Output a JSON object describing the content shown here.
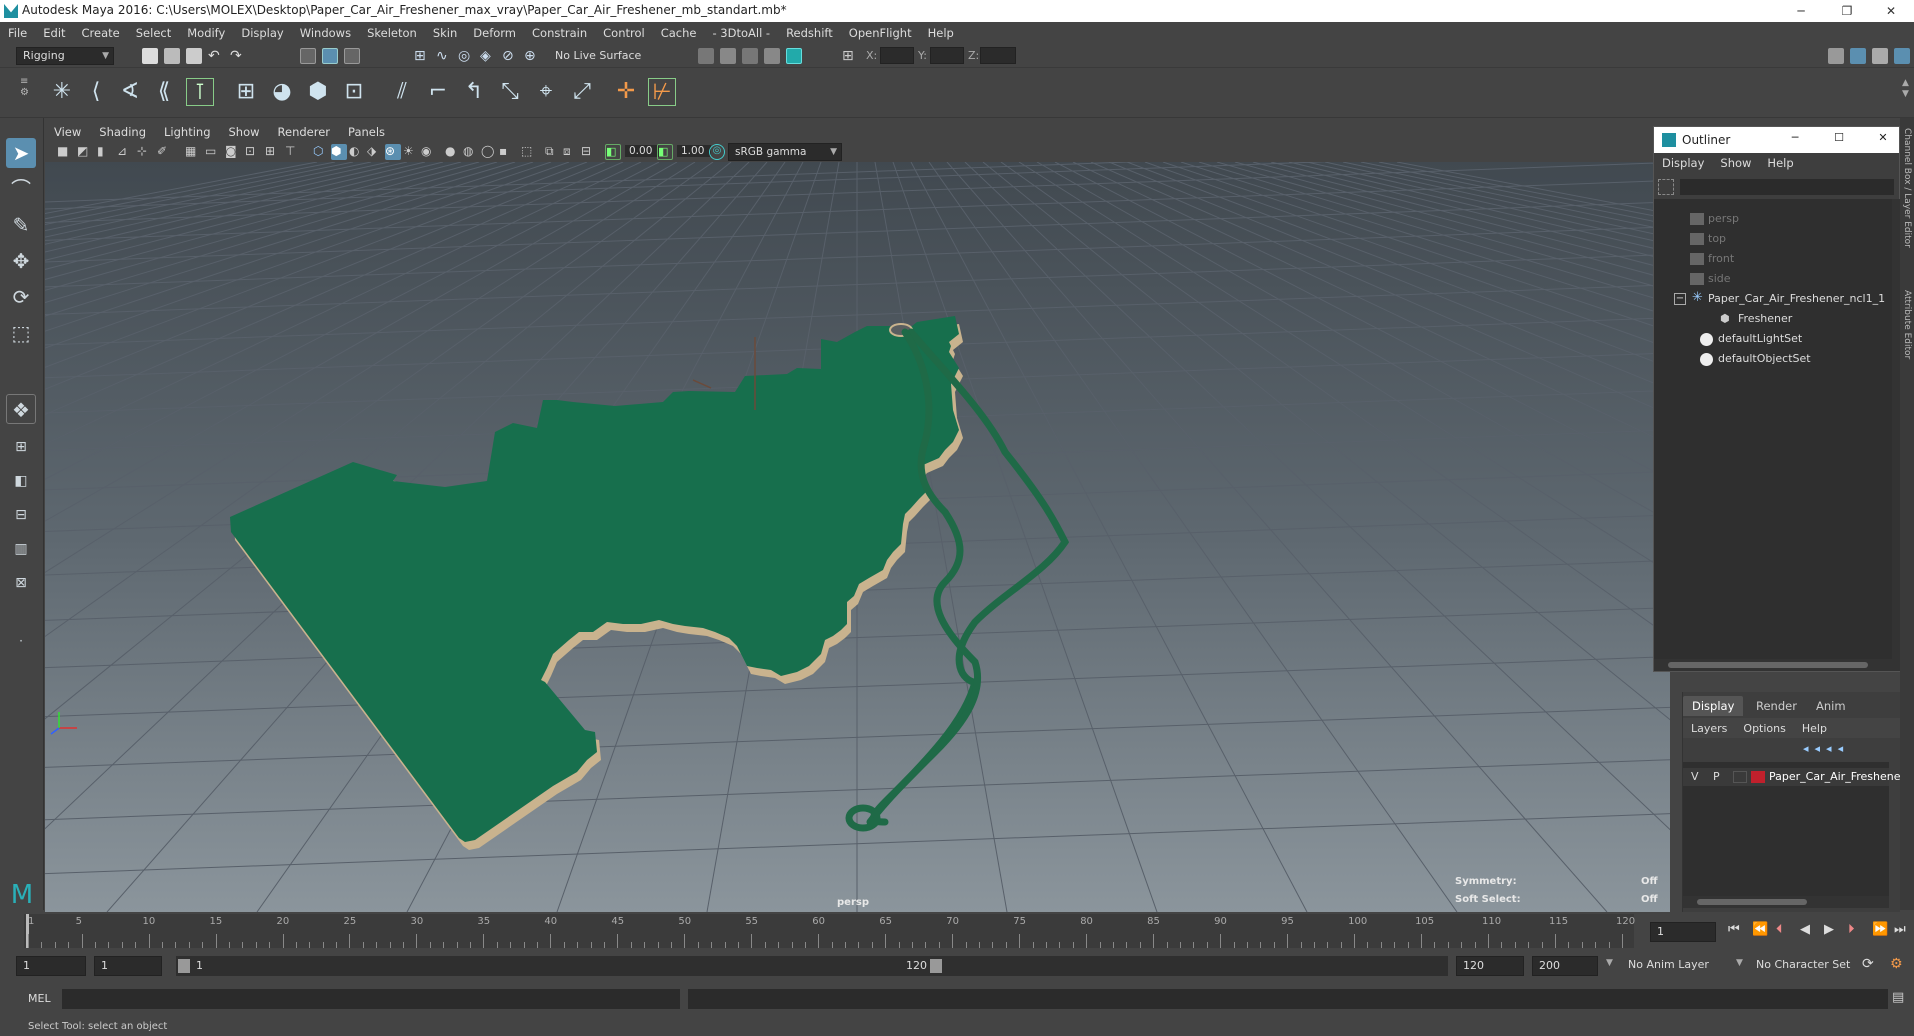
{
  "window": {
    "title": "Autodesk Maya 2016: C:\\Users\\MOLEX\\Desktop\\Paper_Car_Air_Freshener_max_vray\\Paper_Car_Air_Freshener_mb_standart.mb*",
    "minimize": "─",
    "restore": "❐",
    "close": "✕"
  },
  "menubar": [
    "File",
    "Edit",
    "Create",
    "Select",
    "Modify",
    "Display",
    "Windows",
    "Skeleton",
    "Skin",
    "Deform",
    "Constrain",
    "Control",
    "Cache",
    "- 3DtoAll -",
    "Redshift",
    "OpenFlight",
    "Help"
  ],
  "statusline": {
    "mode": "Rigging",
    "live_surface": "No Live Surface",
    "x_label": "X:",
    "y_label": "Y:",
    "z_label": "Z:"
  },
  "viewport": {
    "menu": [
      "View",
      "Shading",
      "Lighting",
      "Show",
      "Renderer",
      "Panels"
    ],
    "exposure": "0.00",
    "gamma": "1.00",
    "color_space": "sRGB gamma",
    "camera_label": "persp",
    "symmetry_label": "Symmetry:",
    "symmetry_value": "Off",
    "soft_select_label": "Soft Select:",
    "soft_select_value": "Off",
    "model_color": "#176f4d",
    "edge_color": "#c9b38e",
    "cord_color": "#1f6a47"
  },
  "outliner": {
    "title": "Outliner",
    "menu": [
      "Display",
      "Show",
      "Help"
    ],
    "items": [
      {
        "label": "persp",
        "dim": true
      },
      {
        "label": "top",
        "dim": true
      },
      {
        "label": "front",
        "dim": true
      },
      {
        "label": "side",
        "dim": true
      },
      {
        "label": "Paper_Car_Air_Freshener_ncl1_1",
        "dim": false
      },
      {
        "label": "Freshener",
        "dim": false
      },
      {
        "label": "defaultLightSet",
        "dim": false
      },
      {
        "label": "defaultObjectSet",
        "dim": false
      }
    ]
  },
  "layer_editor": {
    "tabs": [
      "Display",
      "Render",
      "Anim"
    ],
    "menu": [
      "Layers",
      "Options",
      "Help"
    ],
    "layer": {
      "v": "V",
      "p": "P",
      "name": "Paper_Car_Air_Freshener",
      "color": "#c0202c"
    }
  },
  "right_strip": {
    "channel_box": "Channel Box / Layer Editor",
    "attribute_editor": "Attribute Editor"
  },
  "timeline": {
    "labels": [
      "1",
      "5",
      "10",
      "15",
      "20",
      "25",
      "30",
      "35",
      "40",
      "45",
      "50",
      "55",
      "60",
      "65",
      "70",
      "75",
      "80",
      "85",
      "90",
      "95",
      "100",
      "105",
      "110",
      "115",
      "120"
    ],
    "current_frame": "1"
  },
  "range": {
    "start": "1",
    "playback_start": "1",
    "slider_start": "1",
    "slider_end": "120",
    "playback_end": "120",
    "end": "200",
    "anim_layer": "No Anim Layer",
    "character_set": "No Character Set"
  },
  "cmdline": {
    "label": "MEL"
  },
  "helpline": {
    "text": "Select Tool: select an object"
  }
}
